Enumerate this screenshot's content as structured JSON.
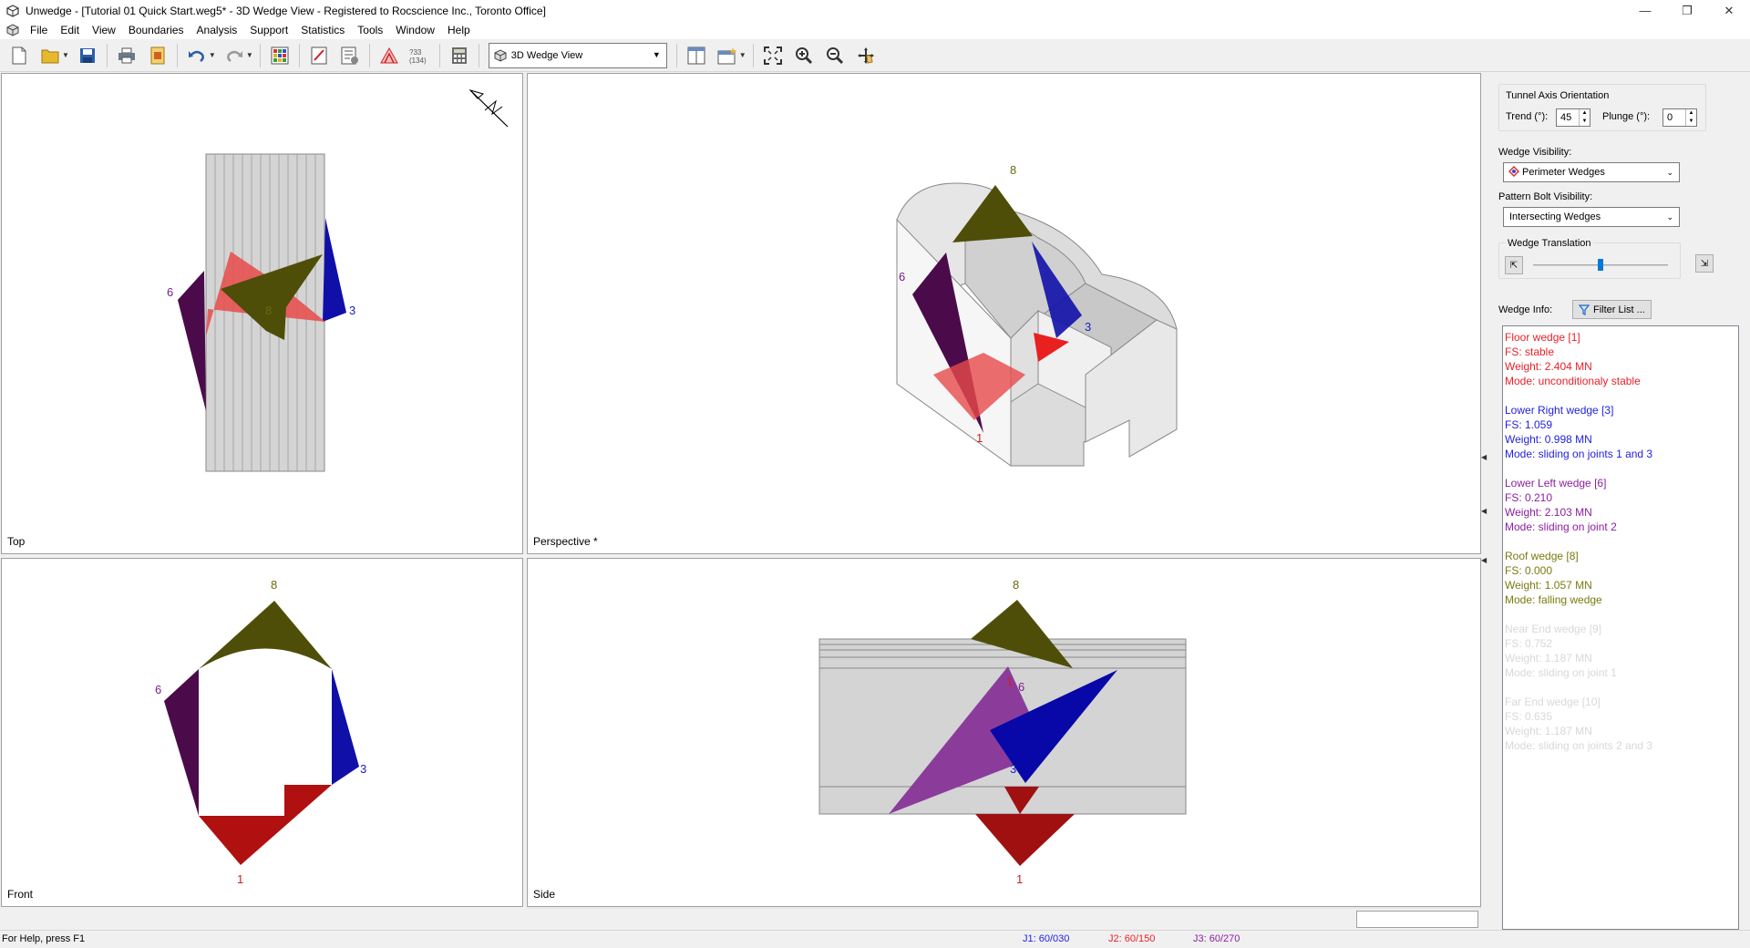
{
  "window": {
    "title": "Unwedge - [Tutorial 01 Quick Start.weg5* - 3D Wedge View - Registered to Rocscience Inc., Toronto Office]",
    "minimize": "—",
    "restore": "❐",
    "close": "✕"
  },
  "menu": [
    "File",
    "Edit",
    "View",
    "Boundaries",
    "Analysis",
    "Support",
    "Statistics",
    "Tools",
    "Window",
    "Help"
  ],
  "toolbar": {
    "view_select": "3D Wedge View",
    "icons": [
      "new-icon",
      "open-icon",
      "save-icon",
      "print-icon",
      "export-icon",
      "undo-icon",
      "redo-icon",
      "project-settings-icon",
      "input-data-icon",
      "compute-icon",
      "wedge-info-icon",
      "bolt-icon",
      "calculator-icon",
      "split-view-icon",
      "add-view-icon",
      "zoom-extents-icon",
      "zoom-in-icon",
      "zoom-out-icon",
      "pan-icon"
    ],
    "bolt_badge": "?33 (134)"
  },
  "views": {
    "top": {
      "label": "Top",
      "wedge_labels": {
        "w6": "6",
        "w3": "3",
        "w8": "8"
      }
    },
    "perspective": {
      "label": "Perspective *",
      "north": "N",
      "wedge_labels": {
        "w8": "8",
        "w6": "6",
        "w3": "3",
        "w1": "1"
      }
    },
    "front": {
      "label": "Front",
      "wedge_labels": {
        "w8": "8",
        "w6": "6",
        "w3": "3",
        "w1": "1"
      }
    },
    "side": {
      "label": "Side",
      "wedge_labels": {
        "w8": "8",
        "w6": "6",
        "w3": "3",
        "w1": "1",
        "w1b": "1"
      }
    }
  },
  "panel": {
    "tunnel_axis": {
      "title": "Tunnel Axis Orientation",
      "trend_label": "Trend (°):",
      "trend_value": "45",
      "plunge_label": "Plunge (°):",
      "plunge_value": "0"
    },
    "wedge_visibility": {
      "label": "Wedge Visibility:",
      "value": "Perimeter Wedges"
    },
    "bolt_visibility": {
      "label": "Pattern Bolt Visibility:",
      "value": "Intersecting Wedges"
    },
    "translation": {
      "title": "Wedge Translation",
      "level": 0.5
    },
    "wedge_info_label": "Wedge Info:",
    "filter_button": "Filter List ..."
  },
  "wedges": [
    {
      "name": "Floor wedge [1]",
      "fs": "FS: stable",
      "weight": "Weight: 2.404 MN",
      "mode": "Mode: unconditionaly stable",
      "color": "#e8212a"
    },
    {
      "name": "Lower Right wedge [3]",
      "fs": "FS: 1.059",
      "weight": "Weight: 0.998 MN",
      "mode": "Mode: sliding on joints 1 and 3",
      "color": "#1f1fe0"
    },
    {
      "name": "Lower Left wedge [6]",
      "fs": "FS: 0.210",
      "weight": "Weight: 2.103 MN",
      "mode": "Mode: sliding on joint 2",
      "color": "#8b1fa0"
    },
    {
      "name": "Roof wedge [8]",
      "fs": "FS: 0.000",
      "weight": "Weight: 1.057 MN",
      "mode": "Mode: falling wedge",
      "color": "#7a7a10"
    },
    {
      "name": "Near End wedge [9]",
      "fs": "FS: 0.752",
      "weight": "Weight: 1.187 MN",
      "mode": "Mode: sliding on joint 1",
      "color": "#d8d8d8"
    },
    {
      "name": "Far End wedge [10]",
      "fs": "FS: 0.635",
      "weight": "Weight: 1.187 MN",
      "mode": "Mode: sliding on joints 2 and 3",
      "color": "#d8d8d8"
    }
  ],
  "status": {
    "help": "For Help, press F1",
    "j1": "J1: 60/030",
    "j2": "J2: 60/150",
    "j3": "J3: 60/270",
    "j1_color": "#1f1fe0",
    "j2_color": "#e8212a",
    "j3_color": "#8b1fa0"
  }
}
